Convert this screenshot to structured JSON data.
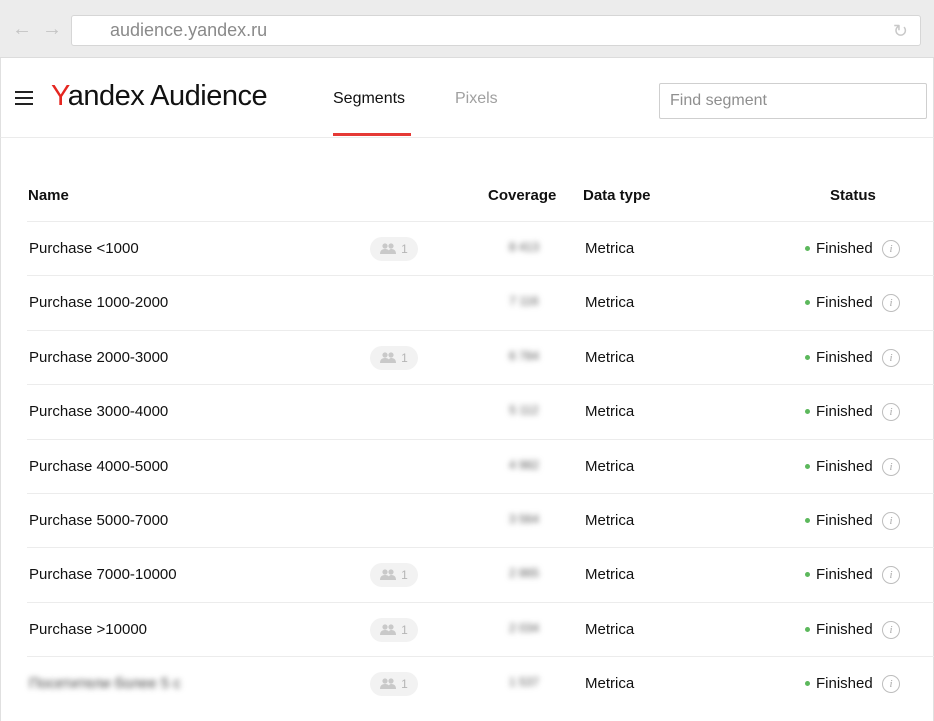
{
  "browser": {
    "url": "audience.yandex.ru",
    "back_icon": "arrow-left-icon",
    "forward_icon": "arrow-right-icon",
    "reload_icon": "reload-icon"
  },
  "header": {
    "logo_first": "Y",
    "logo_rest": "andex Audience",
    "brand_color": "#e52620",
    "tabs": [
      {
        "label": "Segments",
        "active": true
      },
      {
        "label": "Pixels",
        "active": false
      }
    ],
    "search": {
      "placeholder": "Find segment",
      "value": ""
    }
  },
  "table": {
    "columns": {
      "name": "Name",
      "coverage": "Coverage",
      "data_type": "Data type",
      "status": "Status"
    },
    "rows": [
      {
        "name": "Purchase <1000",
        "shared": true,
        "share_count": "1",
        "coverage": "8 413",
        "data_type": "Metrica",
        "status": "Finished"
      },
      {
        "name": "Purchase 1000-2000",
        "shared": false,
        "share_count": "",
        "coverage": "7 116",
        "data_type": "Metrica",
        "status": "Finished"
      },
      {
        "name": "Purchase 2000-3000",
        "shared": true,
        "share_count": "1",
        "coverage": "6 784",
        "data_type": "Metrica",
        "status": "Finished"
      },
      {
        "name": "Purchase 3000-4000",
        "shared": false,
        "share_count": "",
        "coverage": "5 112",
        "data_type": "Metrica",
        "status": "Finished"
      },
      {
        "name": "Purchase 4000-5000",
        "shared": false,
        "share_count": "",
        "coverage": "4 982",
        "data_type": "Metrica",
        "status": "Finished"
      },
      {
        "name": "Purchase 5000-7000",
        "shared": false,
        "share_count": "",
        "coverage": "3 564",
        "data_type": "Metrica",
        "status": "Finished"
      },
      {
        "name": "Purchase 7000-10000",
        "shared": true,
        "share_count": "1",
        "coverage": "2 865",
        "data_type": "Metrica",
        "status": "Finished"
      },
      {
        "name": "Purchase >10000",
        "shared": true,
        "share_count": "1",
        "coverage": "2 034",
        "data_type": "Metrica",
        "status": "Finished"
      },
      {
        "name": "Посетители более 5 с",
        "shared": true,
        "share_count": "1",
        "coverage": "1 537",
        "data_type": "Metrica",
        "status": "Finished",
        "blurred": true
      }
    ]
  },
  "colors": {
    "accent": "#e53935",
    "status_finished": "#5cb85c"
  }
}
